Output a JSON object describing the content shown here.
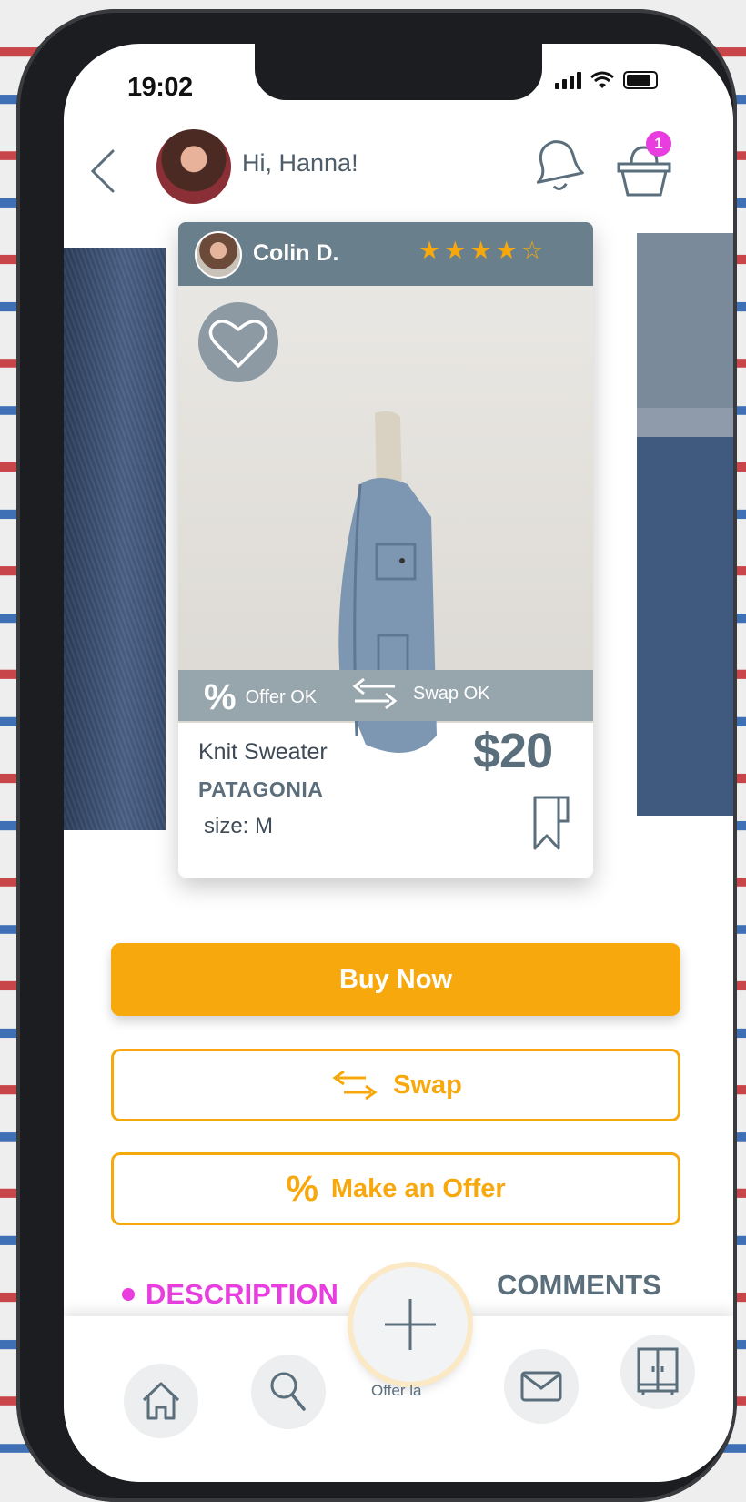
{
  "status_bar": {
    "time": "19:02"
  },
  "header": {
    "greeting": "Hi, Hanna!",
    "cart_count": "1"
  },
  "card": {
    "seller_name": "Colin D.",
    "rating": 4,
    "rating_max": 5,
    "tags": {
      "offer": "Offer OK",
      "swap": "Swap OK"
    },
    "title": "Knit Sweater",
    "brand": "PATAGONIA",
    "size": "size: M",
    "price": "$20"
  },
  "actions": {
    "buy": "Buy Now",
    "swap": "Swap",
    "offer": "Make an Offer"
  },
  "tabs": {
    "description": "DESCRIPTION",
    "comments": "COMMENTS"
  },
  "bottom_nav": {
    "fab_caption": "Offer la",
    "items": [
      "home-icon",
      "search-icon",
      "add-icon",
      "mail-icon",
      "closet-icon"
    ]
  },
  "colors": {
    "accent": "#f7a80c",
    "highlight": "#e83ee0",
    "slate": "#5a6e7c"
  }
}
